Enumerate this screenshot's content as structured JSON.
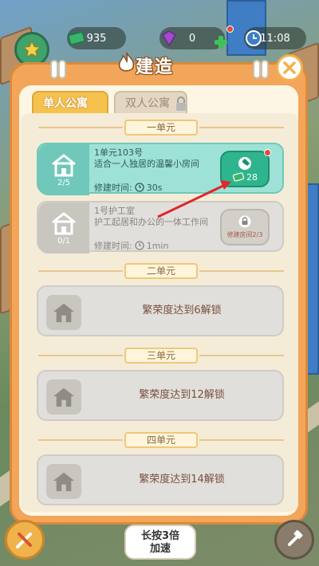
{
  "hud": {
    "cash": "935",
    "gems": "0",
    "clock": "11:08"
  },
  "title": "建造",
  "tabs": [
    {
      "label": "单人公寓",
      "active": true
    },
    {
      "label": "双人公寓",
      "active": false,
      "locked": true
    }
  ],
  "sections": [
    {
      "header": "一单元",
      "cards": [
        {
          "state": "available",
          "count": "2/5",
          "name": "1单元103号",
          "desc": "适合一人独居的温馨小房间",
          "time_label": "修建时间:",
          "time_value": "30s",
          "cost": "28"
        },
        {
          "state": "locked",
          "count": "0/1",
          "name": "1号护工室",
          "desc": "护工起居和办公的一体工作间",
          "time_label": "修建时间:",
          "time_value": "1min",
          "lock_text": "修建房间2/3"
        }
      ]
    },
    {
      "header": "二单元",
      "unlock_text": "繁荣度达到6解锁"
    },
    {
      "header": "三单元",
      "unlock_text": "繁荣度达到12解锁"
    },
    {
      "header": "四单元",
      "unlock_text": "繁荣度达到14解锁"
    }
  ],
  "bottom": {
    "speed_line1": "长按3倍",
    "speed_line2": "加速"
  },
  "colors": {
    "panel_orange": "#f3a55a",
    "teal_card": "#9ee2d7",
    "build_green": "#2fb58d",
    "arrow_red": "#e0262a"
  }
}
